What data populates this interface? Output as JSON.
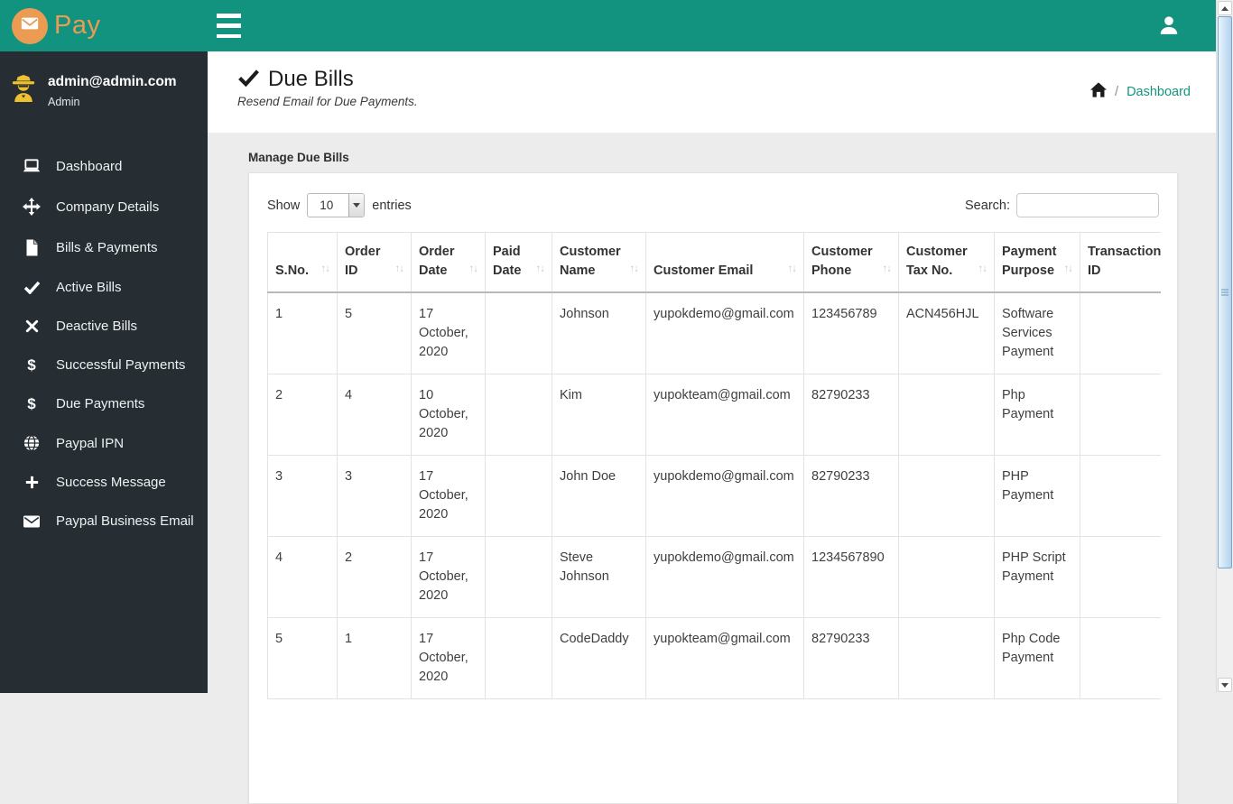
{
  "colors": {
    "topbar_teal": "#119380",
    "sidebar_dark": "#262E33",
    "brand_orange": "#EC9B53",
    "admin_yellow": "#F0C12F",
    "link_teal": "#15957E"
  },
  "brand": {
    "name": "Pay",
    "logo_icon": "envelope-icon"
  },
  "user": {
    "email": "admin@admin.com",
    "role": "Admin",
    "icon": "spy-icon"
  },
  "sidebar": {
    "items": [
      {
        "label": "Dashboard",
        "icon": "laptop-icon"
      },
      {
        "label": "Company Details",
        "icon": "move-icon"
      },
      {
        "label": "Bills & Payments",
        "icon": "file-icon"
      },
      {
        "label": "Active Bills",
        "icon": "check-icon"
      },
      {
        "label": "Deactive Bills",
        "icon": "close-icon"
      },
      {
        "label": "Successful Payments",
        "icon": "dollar-icon"
      },
      {
        "label": "Due Payments",
        "icon": "dollar-icon"
      },
      {
        "label": "Paypal IPN",
        "icon": "globe-icon"
      },
      {
        "label": "Success Message",
        "icon": "plus-icon"
      },
      {
        "label": "Paypal Business Email",
        "icon": "envelope-icon"
      }
    ]
  },
  "page_header": {
    "title": "Due Bills",
    "subtitle": "Resend Email for Due Payments.",
    "breadcrumb": {
      "separator": "/",
      "current": "Dashboard"
    }
  },
  "main": {
    "section_title": "Manage Due Bills",
    "length_control": {
      "show_label": "Show",
      "value": "10",
      "entries_label": "entries"
    },
    "search": {
      "label": "Search:",
      "value": "",
      "placeholder": ""
    },
    "table": {
      "columns": [
        {
          "label": "S.No.",
          "sortable": true
        },
        {
          "label": "Order ID",
          "sortable": true
        },
        {
          "label": "Order Date",
          "sortable": true
        },
        {
          "label": "Paid Date",
          "sortable": true
        },
        {
          "label": "Customer Name",
          "sortable": true
        },
        {
          "label": "Customer Email",
          "sortable": true
        },
        {
          "label": "Customer Phone",
          "sortable": true
        },
        {
          "label": "Customer Tax No.",
          "sortable": true
        },
        {
          "label": "Payment Purpose",
          "sortable": true
        },
        {
          "label": "Transaction ID",
          "sortable": false
        }
      ],
      "rows": [
        [
          "1",
          "5",
          "17 October, 2020",
          "",
          "Johnson",
          "yupokdemo@gmail.com",
          "123456789",
          "ACN456HJL",
          "Software Services Payment",
          ""
        ],
        [
          "2",
          "4",
          "10 October, 2020",
          "",
          "Kim",
          "yupokteam@gmail.com",
          "82790233",
          "",
          "Php Payment",
          ""
        ],
        [
          "3",
          "3",
          "17 October, 2020",
          "",
          "John Doe",
          "yupokdemo@gmail.com",
          "82790233",
          "",
          "PHP Payment",
          ""
        ],
        [
          "4",
          "2",
          "17 October, 2020",
          "",
          "Steve Johnson",
          "yupokdemo@gmail.com",
          "1234567890",
          "",
          "PHP Script Payment",
          ""
        ],
        [
          "5",
          "1",
          "17 October, 2020",
          "",
          "CodeDaddy",
          "yupokteam@gmail.com",
          "82790233",
          "",
          "Php Code Payment",
          ""
        ]
      ]
    }
  }
}
